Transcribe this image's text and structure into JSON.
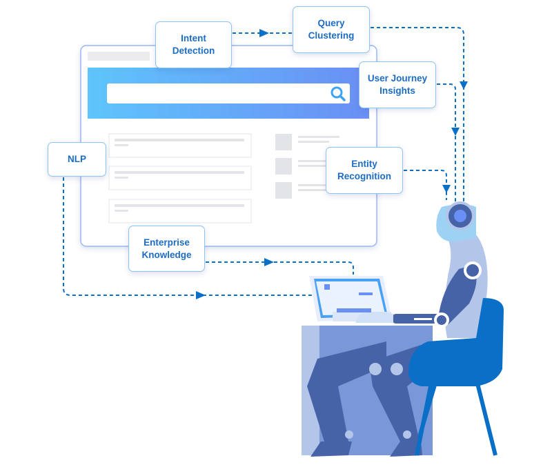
{
  "labels": {
    "intent_detection": "Intent Detection",
    "query_clustering": "Query Clustering",
    "user_journey_insights": "User Journey Insights",
    "nlp": "NLP",
    "entity_recognition": "Entity Recognition",
    "enterprise_knowledge": "Enterprise Knowledge"
  },
  "icons": {
    "search": "search-icon"
  },
  "colors": {
    "accent": "#1c6cc4",
    "dashed_line": "#0a6fc7",
    "chair": "#0a6fc7",
    "robot_dark": "#4763a8",
    "robot_light": "#b3c6ea",
    "header_gradient_start": "#5ec4fb",
    "header_gradient_end": "#6a8ff5"
  }
}
